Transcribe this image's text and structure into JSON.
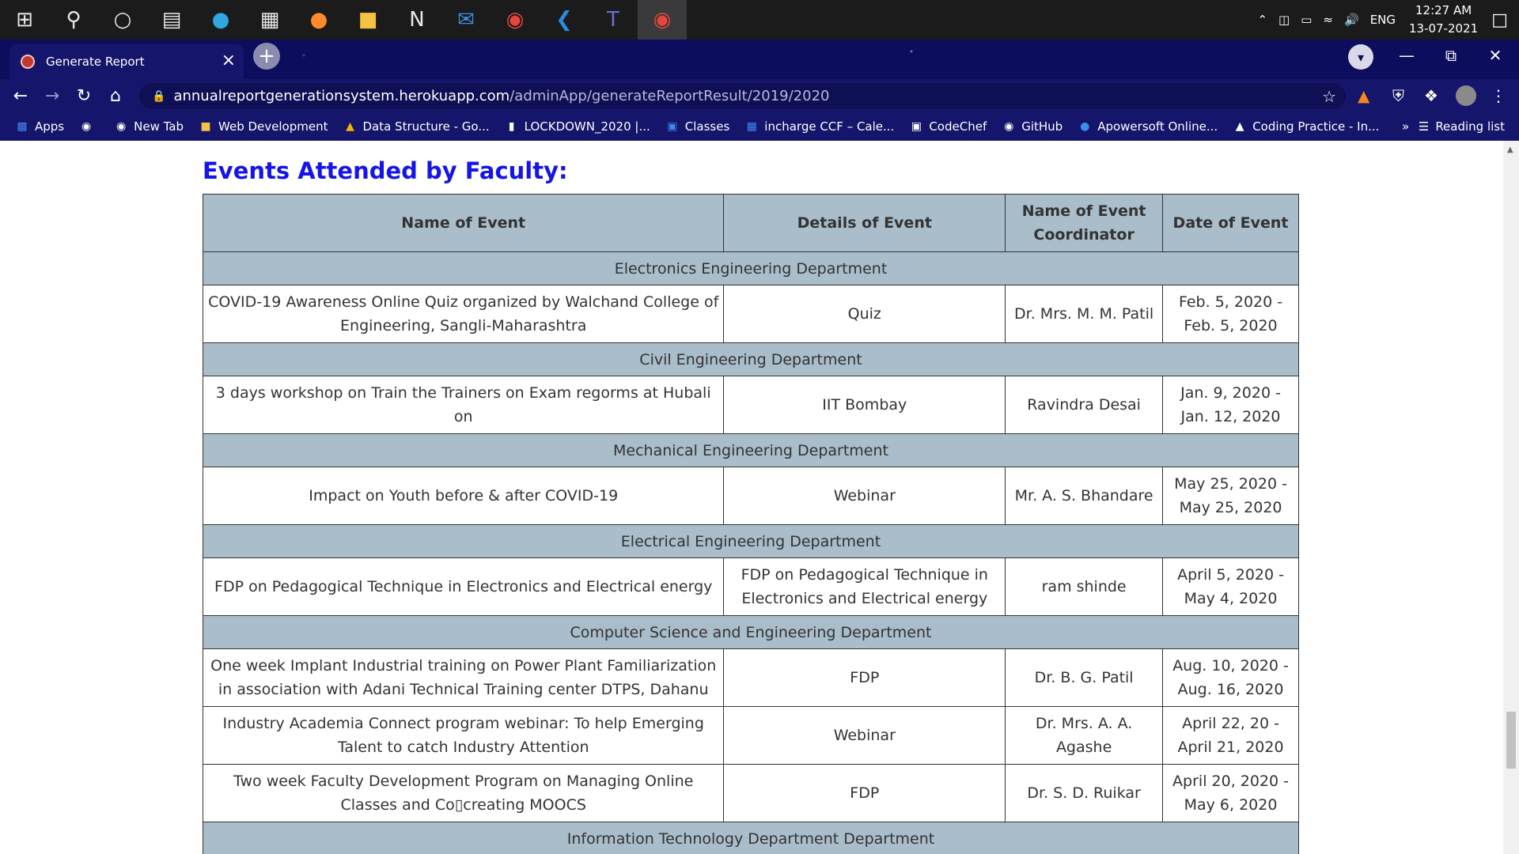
{
  "taskbar": {
    "icons": [
      "windows-start",
      "search",
      "cortana",
      "task-view",
      "edge",
      "store",
      "firefox",
      "file-explorer",
      "notion",
      "mail",
      "chrome",
      "vscode",
      "teams",
      "chrome-profile"
    ],
    "tray": {
      "language": "ENG",
      "time": "12:27 AM",
      "date": "13-07-2021"
    }
  },
  "browser": {
    "tab_title": "Generate Report",
    "url_host": "annualreportgenerationsystem.herokuapp.com",
    "url_path": "/adminApp/generateReportResult/2019/2020",
    "bookmarks": [
      "Apps",
      "",
      "New Tab",
      "Web Development",
      "Data Structure - Go...",
      "LOCKDOWN_2020 |...",
      "Classes",
      "incharge CCF – Cale...",
      "CodeChef",
      "GitHub",
      "Apowersoft Online...",
      "Coding Practice - In..."
    ],
    "overflow": "»",
    "reading_list": "Reading list"
  },
  "page": {
    "section_title": "Events Attended by Faculty:",
    "table": {
      "headers": [
        "Name of Event",
        "Details of Event",
        "Name of Event Coordinator",
        "Date of Event"
      ],
      "groups": [
        {
          "department": "Electronics Engineering Department",
          "rows": [
            {
              "name": "COVID-19 Awareness Online Quiz organized by Walchand College of Engineering, Sangli-Maharashtra",
              "details": "Quiz",
              "coordinator": "Dr. Mrs. M. M. Patil",
              "date": "Feb. 5, 2020 - Feb. 5, 2020"
            }
          ]
        },
        {
          "department": "Civil Engineering Department",
          "rows": [
            {
              "name": "3 days workshop on Train the Trainers on Exam regorms at Hubali on",
              "details": "IIT Bombay",
              "coordinator": "Ravindra Desai",
              "date": "Jan. 9, 2020 - Jan. 12, 2020"
            }
          ]
        },
        {
          "department": "Mechanical Engineering Department",
          "rows": [
            {
              "name": "Impact on Youth before & after COVID-19",
              "details": "Webinar",
              "coordinator": "Mr. A. S. Bhandare",
              "date": "May 25, 2020 - May 25, 2020"
            }
          ]
        },
        {
          "department": "Electrical Engineering Department",
          "rows": [
            {
              "name": "FDP on Pedagogical Technique in Electronics and Electrical energy",
              "details": "FDP on Pedagogical Technique in Electronics and Electrical energy",
              "coordinator": "ram shinde",
              "date": "April 5, 2020 - May 4, 2020"
            }
          ]
        },
        {
          "department": "Computer Science and Engineering Department",
          "rows": [
            {
              "name": "One week Implant Industrial training on Power Plant Familiarization in association with Adani Technical Training center DTPS, Dahanu",
              "details": "FDP",
              "coordinator": "Dr. B. G. Patil",
              "date": "Aug. 10, 2020 - Aug. 16, 2020"
            },
            {
              "name": "Industry Academia Connect program webinar: To help Emerging Talent to catch Industry Attention",
              "details": "Webinar",
              "coordinator": "Dr. Mrs. A. A. Agashe",
              "date": "April 22, 20 - April 21, 2020"
            },
            {
              "name": "Two week Faculty Development Program on Managing Online Classes and Co▯creating MOOCS",
              "details": "FDP",
              "coordinator": "Dr. S. D. Ruikar",
              "date": "April 20, 2020 - May 6, 2020"
            }
          ]
        },
        {
          "department": "Information Technology Department Department",
          "rows": []
        }
      ]
    }
  }
}
